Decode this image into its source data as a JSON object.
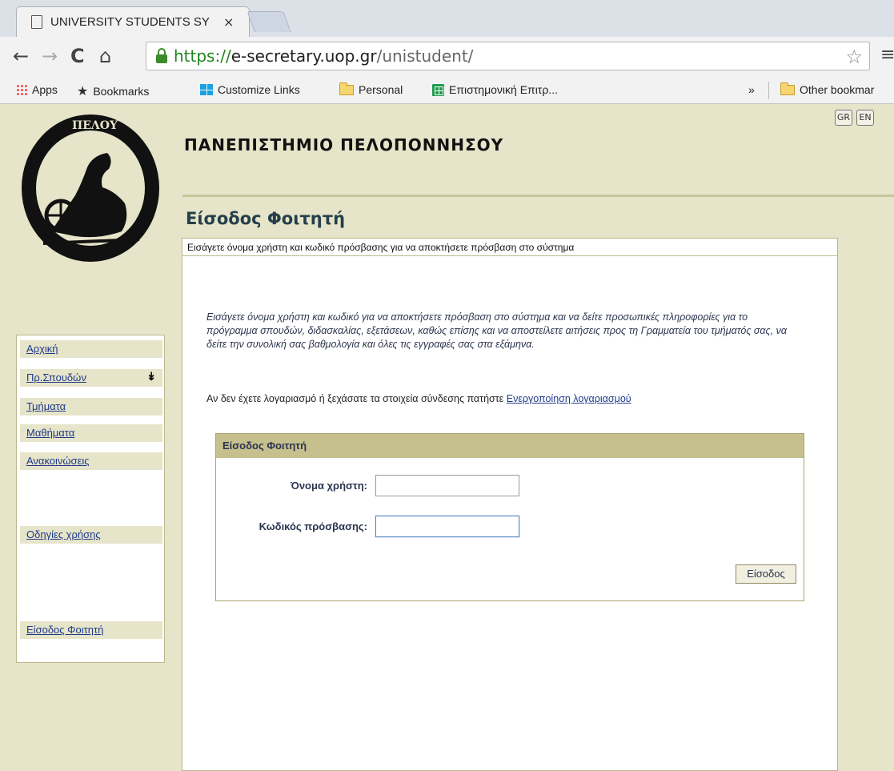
{
  "browser": {
    "tab_title": "UNIVERSITY STUDENTS SY",
    "tab_close": "×",
    "url_scheme": "https://",
    "url_host": "e-secretary.uop.gr",
    "url_path": "/unistudent/",
    "nav": {
      "back": "←",
      "forward": "→",
      "reload": "C",
      "home": "⌂",
      "star": "☆",
      "menu": "≡"
    },
    "bookmarks": [
      {
        "label": "Apps",
        "icon": "apps-grid-icon"
      },
      {
        "label": "Bookmarks",
        "icon": "star-icon"
      },
      {
        "label": "Customize Links",
        "icon": "windows-icon"
      },
      {
        "label": "Personal",
        "icon": "folder-icon"
      },
      {
        "label": "Επιστημονική Επιτρ...",
        "icon": "spreadsheet-icon"
      }
    ],
    "overflow": "»",
    "other_bookmarks": "Other bookmar"
  },
  "header": {
    "university": "ΠΑΝΕΠΙΣΤΗΜΙΟ ΠΕΛΟΠΟΝΝΗΣΟΥ",
    "lang_gr": "GR",
    "lang_en": "EN",
    "logo_text": "ΠΕΛΟΥ"
  },
  "page_heading": "Είσοδος Φοιτητή",
  "sidebar": {
    "items": [
      {
        "label": "Αρχική"
      },
      {
        "label": "Πρ.Σπουδών",
        "arrow": "↡"
      },
      {
        "label": "Τμήματα"
      },
      {
        "label": "Μαθήματα"
      },
      {
        "label": "Ανακοινώσεις"
      },
      {
        "label": "Οδηγίες χρήσης"
      },
      {
        "label": "Είσοδος Φοιτητή"
      }
    ]
  },
  "main": {
    "top_bar": "Εισάγετε όνομα χρήστη και κωδικό πρόσβασης για να αποκτήσετε πρόσβαση στο σύστημα",
    "intro": "Εισάγετε όνομα χρήστη και κωδικό για να αποκτήσετε πρόσβαση στο σύστημα και να δείτε προσωπικές πληροφορίες για το πρόγραμμα σπουδών, διδασκαλίας, εξετάσεων, καθώς επίσης και να αποστείλετε αιτήσεις προς τη Γραμματεία του τμήματός σας, να δείτε την συνολική σας βαθμολογία και όλες τις εγγραφές σας στα εξάμηνα.",
    "activate_text": "Αν δεν έχετε λογαριασμό ή ξεχάσατε τα στοιχεία σύνδεσης πατήστε ",
    "activate_link": "Ενεργοποίηση λογαριασμού"
  },
  "login": {
    "title": "Είσοδος Φοιτητή",
    "username_label": "Όνομα χρήστη:",
    "username_value": "",
    "password_label": "Κωδικός πρόσβασης:",
    "password_value": "",
    "submit_label": "Είσοδος"
  },
  "colors": {
    "page_bg": "#e6e4c9",
    "header_bar": "#c5c08e",
    "link": "#1f3a8a",
    "heading": "#253f4c"
  }
}
